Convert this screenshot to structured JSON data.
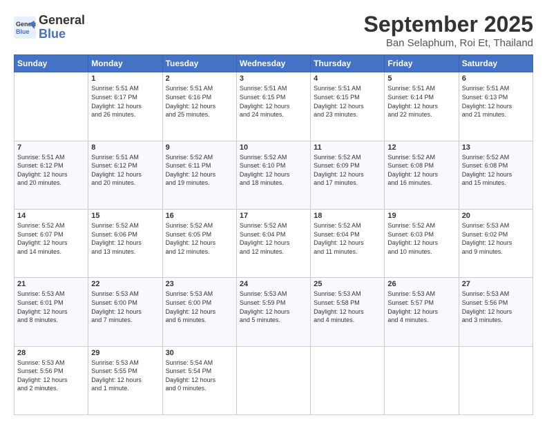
{
  "header": {
    "logo_line1": "General",
    "logo_line2": "Blue",
    "month": "September 2025",
    "location": "Ban Selaphum, Roi Et, Thailand"
  },
  "weekdays": [
    "Sunday",
    "Monday",
    "Tuesday",
    "Wednesday",
    "Thursday",
    "Friday",
    "Saturday"
  ],
  "weeks": [
    [
      {
        "day": "",
        "info": ""
      },
      {
        "day": "1",
        "info": "Sunrise: 5:51 AM\nSunset: 6:17 PM\nDaylight: 12 hours\nand 26 minutes."
      },
      {
        "day": "2",
        "info": "Sunrise: 5:51 AM\nSunset: 6:16 PM\nDaylight: 12 hours\nand 25 minutes."
      },
      {
        "day": "3",
        "info": "Sunrise: 5:51 AM\nSunset: 6:15 PM\nDaylight: 12 hours\nand 24 minutes."
      },
      {
        "day": "4",
        "info": "Sunrise: 5:51 AM\nSunset: 6:15 PM\nDaylight: 12 hours\nand 23 minutes."
      },
      {
        "day": "5",
        "info": "Sunrise: 5:51 AM\nSunset: 6:14 PM\nDaylight: 12 hours\nand 22 minutes."
      },
      {
        "day": "6",
        "info": "Sunrise: 5:51 AM\nSunset: 6:13 PM\nDaylight: 12 hours\nand 21 minutes."
      }
    ],
    [
      {
        "day": "7",
        "info": "Sunrise: 5:51 AM\nSunset: 6:12 PM\nDaylight: 12 hours\nand 20 minutes."
      },
      {
        "day": "8",
        "info": "Sunrise: 5:51 AM\nSunset: 6:12 PM\nDaylight: 12 hours\nand 20 minutes."
      },
      {
        "day": "9",
        "info": "Sunrise: 5:52 AM\nSunset: 6:11 PM\nDaylight: 12 hours\nand 19 minutes."
      },
      {
        "day": "10",
        "info": "Sunrise: 5:52 AM\nSunset: 6:10 PM\nDaylight: 12 hours\nand 18 minutes."
      },
      {
        "day": "11",
        "info": "Sunrise: 5:52 AM\nSunset: 6:09 PM\nDaylight: 12 hours\nand 17 minutes."
      },
      {
        "day": "12",
        "info": "Sunrise: 5:52 AM\nSunset: 6:08 PM\nDaylight: 12 hours\nand 16 minutes."
      },
      {
        "day": "13",
        "info": "Sunrise: 5:52 AM\nSunset: 6:08 PM\nDaylight: 12 hours\nand 15 minutes."
      }
    ],
    [
      {
        "day": "14",
        "info": "Sunrise: 5:52 AM\nSunset: 6:07 PM\nDaylight: 12 hours\nand 14 minutes."
      },
      {
        "day": "15",
        "info": "Sunrise: 5:52 AM\nSunset: 6:06 PM\nDaylight: 12 hours\nand 13 minutes."
      },
      {
        "day": "16",
        "info": "Sunrise: 5:52 AM\nSunset: 6:05 PM\nDaylight: 12 hours\nand 12 minutes."
      },
      {
        "day": "17",
        "info": "Sunrise: 5:52 AM\nSunset: 6:04 PM\nDaylight: 12 hours\nand 12 minutes."
      },
      {
        "day": "18",
        "info": "Sunrise: 5:52 AM\nSunset: 6:04 PM\nDaylight: 12 hours\nand 11 minutes."
      },
      {
        "day": "19",
        "info": "Sunrise: 5:52 AM\nSunset: 6:03 PM\nDaylight: 12 hours\nand 10 minutes."
      },
      {
        "day": "20",
        "info": "Sunrise: 5:53 AM\nSunset: 6:02 PM\nDaylight: 12 hours\nand 9 minutes."
      }
    ],
    [
      {
        "day": "21",
        "info": "Sunrise: 5:53 AM\nSunset: 6:01 PM\nDaylight: 12 hours\nand 8 minutes."
      },
      {
        "day": "22",
        "info": "Sunrise: 5:53 AM\nSunset: 6:00 PM\nDaylight: 12 hours\nand 7 minutes."
      },
      {
        "day": "23",
        "info": "Sunrise: 5:53 AM\nSunset: 6:00 PM\nDaylight: 12 hours\nand 6 minutes."
      },
      {
        "day": "24",
        "info": "Sunrise: 5:53 AM\nSunset: 5:59 PM\nDaylight: 12 hours\nand 5 minutes."
      },
      {
        "day": "25",
        "info": "Sunrise: 5:53 AM\nSunset: 5:58 PM\nDaylight: 12 hours\nand 4 minutes."
      },
      {
        "day": "26",
        "info": "Sunrise: 5:53 AM\nSunset: 5:57 PM\nDaylight: 12 hours\nand 4 minutes."
      },
      {
        "day": "27",
        "info": "Sunrise: 5:53 AM\nSunset: 5:56 PM\nDaylight: 12 hours\nand 3 minutes."
      }
    ],
    [
      {
        "day": "28",
        "info": "Sunrise: 5:53 AM\nSunset: 5:56 PM\nDaylight: 12 hours\nand 2 minutes."
      },
      {
        "day": "29",
        "info": "Sunrise: 5:53 AM\nSunset: 5:55 PM\nDaylight: 12 hours\nand 1 minute."
      },
      {
        "day": "30",
        "info": "Sunrise: 5:54 AM\nSunset: 5:54 PM\nDaylight: 12 hours\nand 0 minutes."
      },
      {
        "day": "",
        "info": ""
      },
      {
        "day": "",
        "info": ""
      },
      {
        "day": "",
        "info": ""
      },
      {
        "day": "",
        "info": ""
      }
    ]
  ]
}
